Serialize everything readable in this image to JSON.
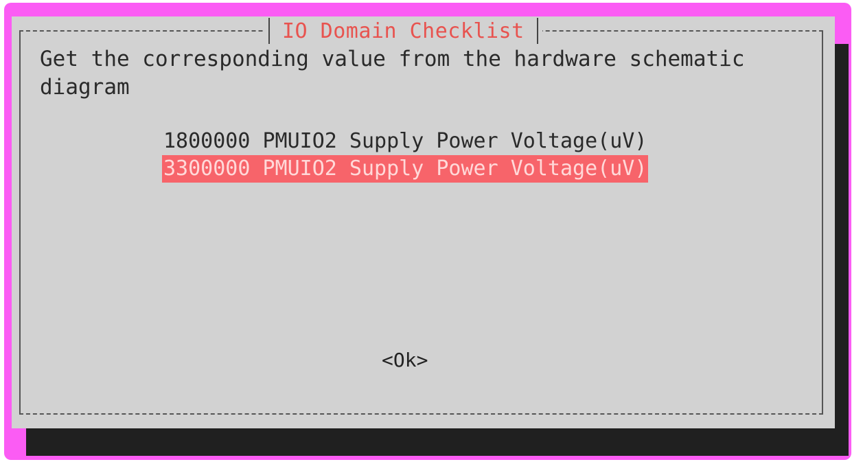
{
  "dialog": {
    "title": "IO Domain Checklist",
    "prompt": "Get the corresponding value from the hardware schematic\ndiagram",
    "options": [
      {
        "label": "1800000 PMUIO2 Supply Power Voltage(uV)",
        "selected": false
      },
      {
        "label": "3300000 PMUIO2 Supply Power Voltage(uV)",
        "selected": true
      }
    ],
    "ok_label": "<Ok>"
  },
  "colors": {
    "outer_border": "#fb5cf4",
    "dialog_bg": "#d2d2d2",
    "title_text": "#e8534f",
    "selection_bg": "#f7646a",
    "shadow": "#202020"
  }
}
